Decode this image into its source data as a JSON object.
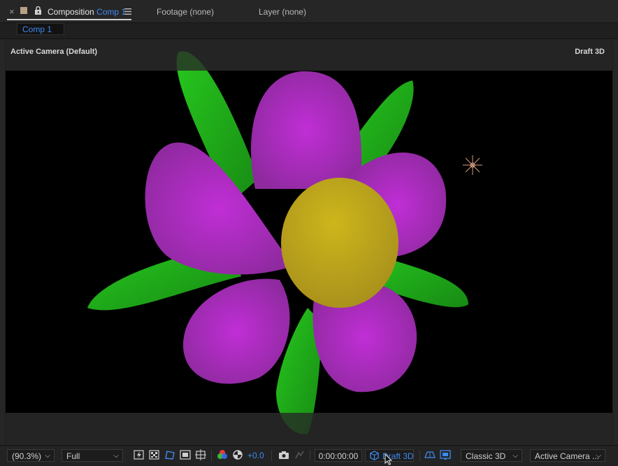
{
  "panel": {
    "close_glyph": "×",
    "composition_label": "Composition",
    "composition_name": "Comp 1",
    "footage_tab": "Footage (none)",
    "layer_tab": "Layer (none)"
  },
  "subtab": {
    "label": "Comp 1"
  },
  "viewer": {
    "camera_label": "Active Camera (Default)",
    "renderer_label": "Draft 3D"
  },
  "toolbar": {
    "magnification": "(90.3%)",
    "resolution": "Full",
    "exposure": "+0.0",
    "timecode": "0:00:00:00",
    "draft3d_label": "Draft 3D",
    "renderer": "Classic 3D",
    "view": "Active Camera ..."
  },
  "colors": {
    "accent_blue": "#3e8bf0",
    "petal": "#b62fc9",
    "center": "#c8b21a",
    "leaf": "#22b41a"
  },
  "icons": [
    "close-icon",
    "label-color-swatch",
    "lock-icon",
    "panel-menu-icon",
    "snapshot-toggle-icon",
    "transparency-grid-icon",
    "mask-path-icon",
    "region-of-interest-icon",
    "grid-guides-icon",
    "color-channels-icon",
    "exposure-reset-icon",
    "camera-snapshot-icon",
    "show-snapshot-icon",
    "draft3d-icon",
    "3d-ground-plane-icon",
    "fast-previews-icon",
    "light-icon"
  ]
}
